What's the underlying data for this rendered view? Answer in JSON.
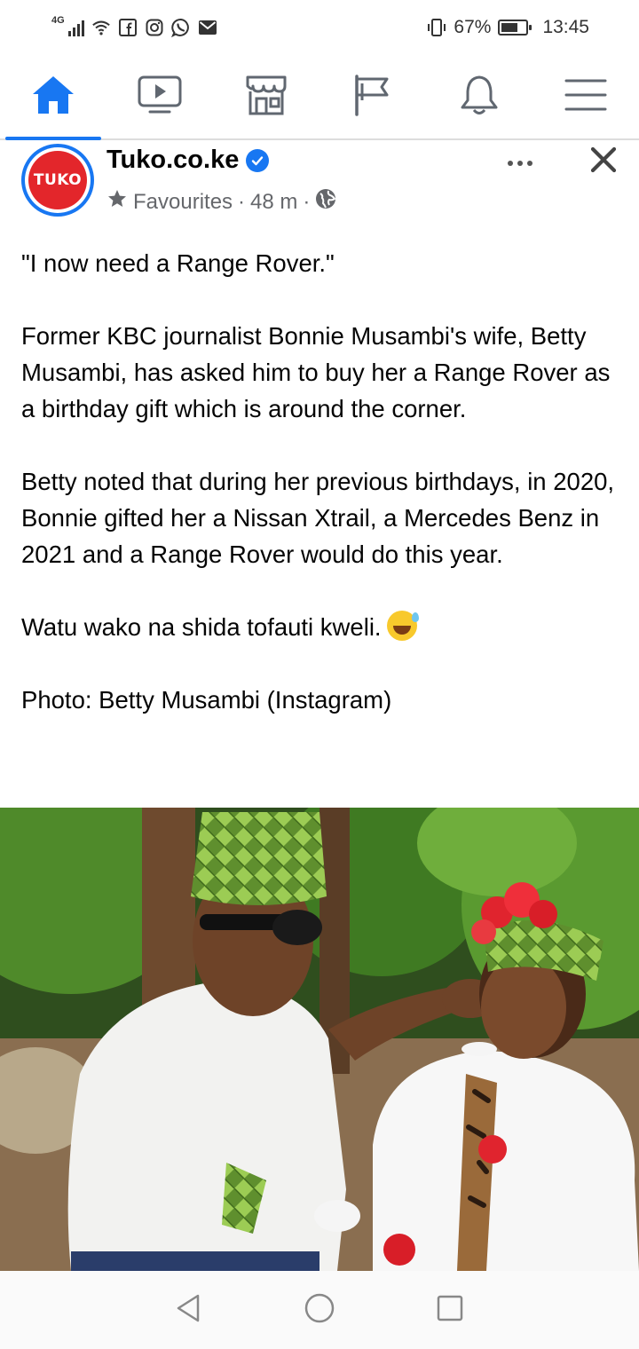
{
  "status_bar": {
    "network": "4G",
    "battery_percent": "67%",
    "battery_level": 0.67,
    "time": "13:45",
    "notification_icons": [
      "facebook-icon",
      "instagram-icon",
      "whatsapp-icon",
      "mail-icon"
    ]
  },
  "nav": {
    "active_tab": "home",
    "tabs": [
      "home-icon",
      "watch-icon",
      "marketplace-icon",
      "pages-flag-icon",
      "notifications-bell-icon",
      "menu-icon"
    ],
    "accent_color": "#1877f2"
  },
  "post": {
    "avatar_text": "TUKO",
    "page_name": "Tuko.co.ke",
    "audience": "Favourites",
    "separator": "·",
    "time_ago": "48 m",
    "paragraphs": {
      "p1": "\"I now need a Range Rover.\"",
      "p2": "Former KBC journalist Bonnie Musambi's wife, Betty Musambi, has asked him to buy her a Range Rover as a birthday gift which is around the corner.",
      "p3": "Betty noted that during her previous birthdays, in 2020, Bonnie gifted her a Nissan Xtrail, a Mercedes Benz in 2021 and a Range Rover would do this year.",
      "p4": "Watu wako na shida tofauti kweli.",
      "p5": "Photo: Betty Musambi (Instagram)"
    },
    "emoji": "grinning-face-with-sweat"
  },
  "android_nav": [
    "back-icon",
    "home-circle-icon",
    "recents-square-icon"
  ]
}
